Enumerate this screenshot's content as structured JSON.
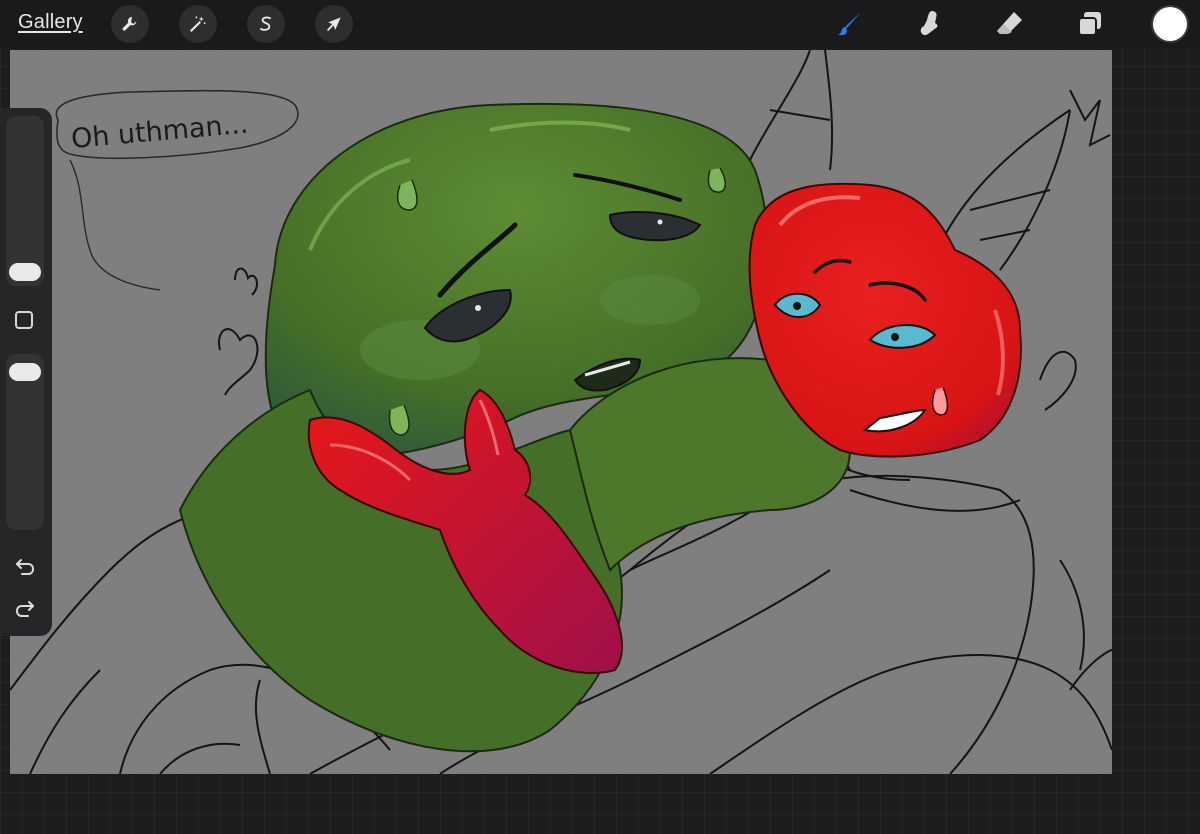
{
  "toolbar": {
    "gallery_label": "Gallery",
    "left_tools": [
      {
        "name": "actions",
        "icon": "wrench-icon"
      },
      {
        "name": "adjustments",
        "icon": "magic-wand-icon"
      },
      {
        "name": "selection",
        "icon": "selection-s-icon"
      },
      {
        "name": "transform",
        "icon": "arrow-cursor-icon"
      }
    ],
    "right_tools": [
      {
        "name": "brush",
        "icon": "brush-icon",
        "active": true
      },
      {
        "name": "smudge",
        "icon": "smudge-icon",
        "active": false
      },
      {
        "name": "eraser",
        "icon": "eraser-icon",
        "active": false
      },
      {
        "name": "layers",
        "icon": "layers-icon",
        "active": false
      }
    ],
    "active_color": "#ffffff",
    "accent_color": "#2f7cf6"
  },
  "sidebar": {
    "brush_size_level": 0.34,
    "opacity_level": 0.05,
    "buttons": [
      "modify-square-icon",
      "undo-icon",
      "redo-icon"
    ]
  },
  "canvas": {
    "background_color": "#7f7f7f",
    "speech_bubble_text": "Oh uthman...",
    "colors": {
      "green_character": "#4f7a2c",
      "red_character": "#e01a1a",
      "sketch_lines": "#141414"
    }
  }
}
